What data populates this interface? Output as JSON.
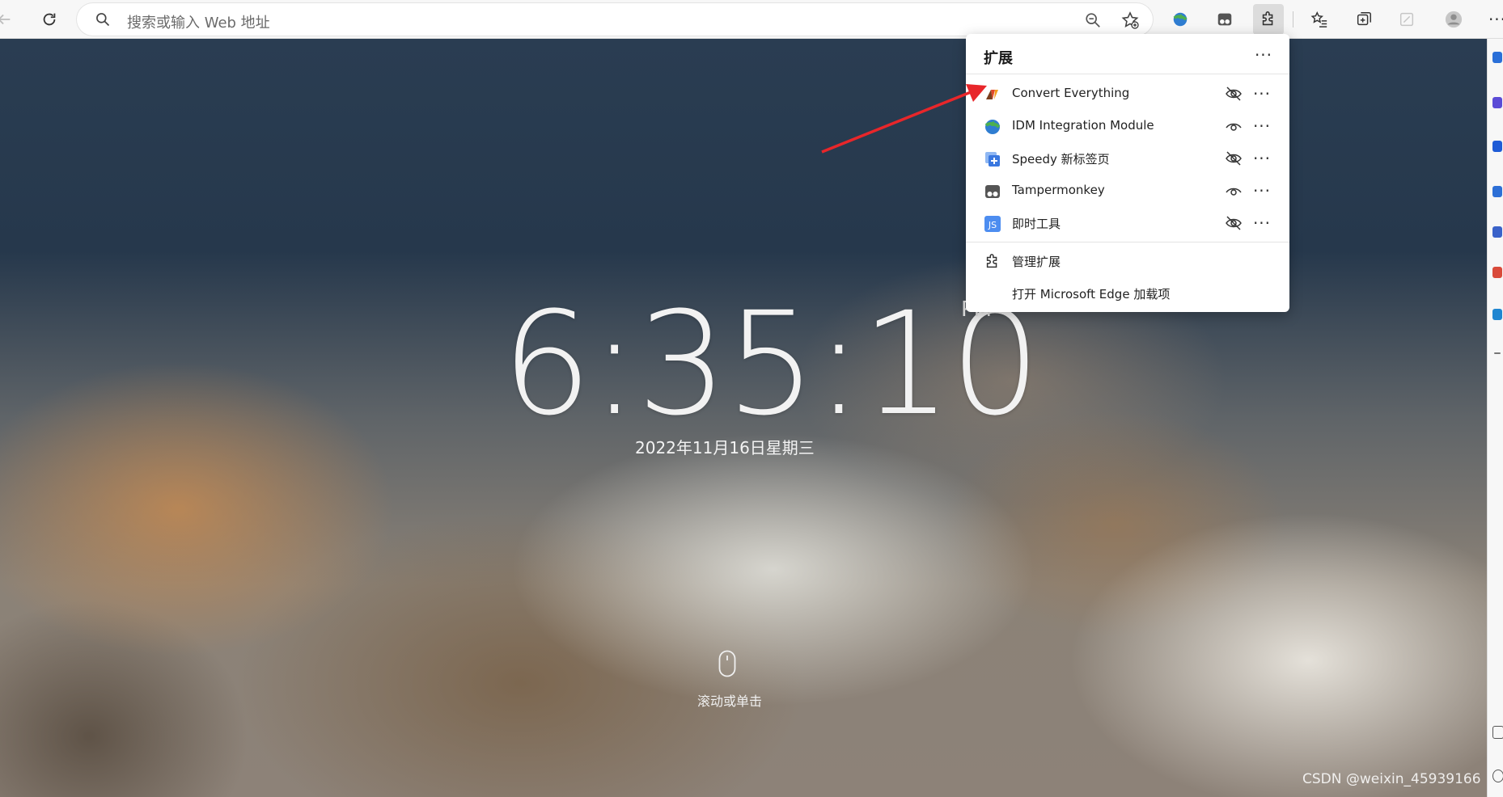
{
  "toolbar": {
    "address_placeholder": "搜索或输入 Web 地址"
  },
  "page": {
    "time": "6:35:10",
    "ampm": "PM",
    "date": "2022年11月16日星期三",
    "scroll_hint": "滚动或单击",
    "watermark": "CSDN @weixin_45939166"
  },
  "extensions_popup": {
    "title": "扩展",
    "extensions": [
      {
        "name": "Convert Everything",
        "visibility": "hidden"
      },
      {
        "name": "IDM Integration Module",
        "visibility": "shown"
      },
      {
        "name": "Speedy 新标签页",
        "visibility": "hidden"
      },
      {
        "name": "Tampermonkey",
        "visibility": "shown"
      },
      {
        "name": "即时工具",
        "visibility": "hidden"
      }
    ],
    "manage_label": "管理扩展",
    "open_addons_label": "打开 Microsoft Edge 加载项"
  },
  "colors": {
    "annotation_arrow": "#e8262a",
    "toolbar_bg": "#f7f7f7",
    "popup_bg": "#ffffff"
  }
}
